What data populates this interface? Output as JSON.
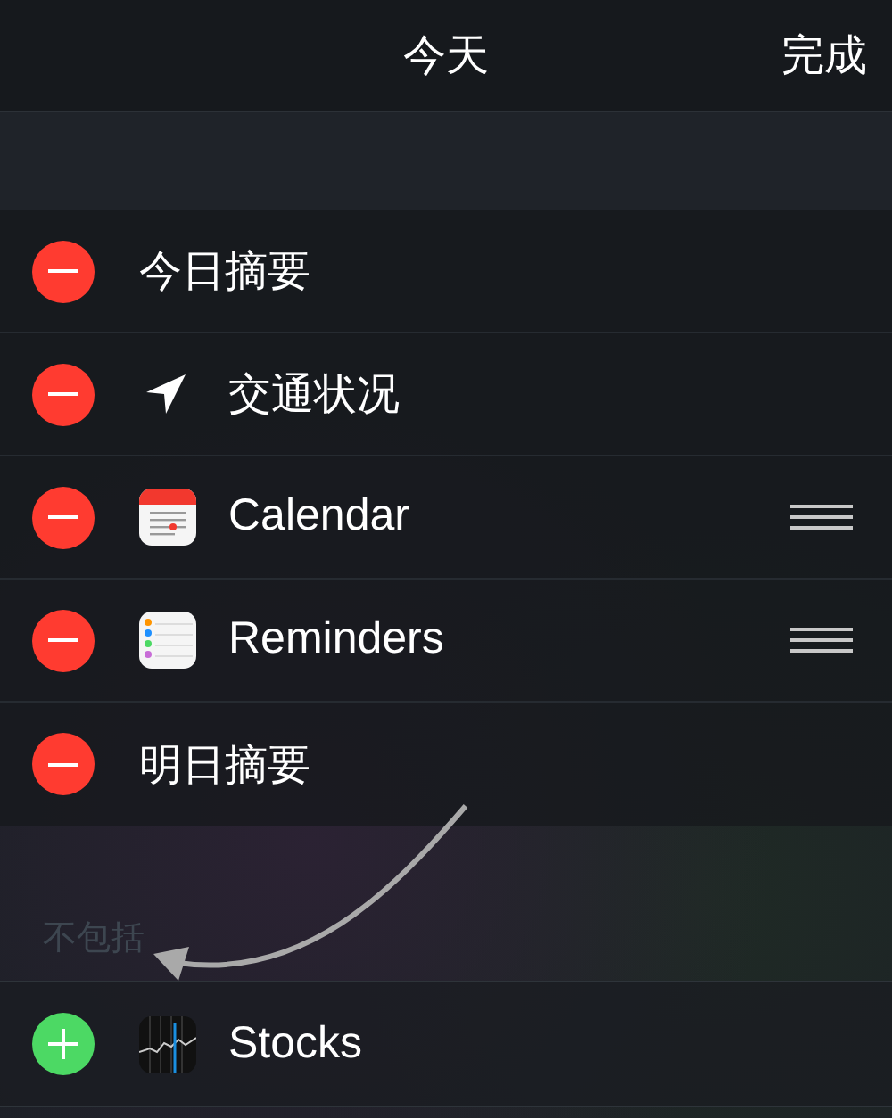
{
  "nav_bar": {
    "title": "今天",
    "done_button": "完成"
  },
  "included": [
    {
      "label": "今日摘要",
      "kind": "text",
      "reorderable": false
    },
    {
      "label": "交通状况",
      "kind": "location",
      "reorderable": false
    },
    {
      "label": "Calendar",
      "kind": "calendar",
      "reorderable": true
    },
    {
      "label": "Reminders",
      "kind": "reminders",
      "reorderable": true
    },
    {
      "label": "明日摘要",
      "kind": "text",
      "reorderable": false
    }
  ],
  "excluded_section": {
    "header": "不包括",
    "rows": [
      {
        "label": "Stocks",
        "kind": "stocks",
        "reorderable": false
      }
    ]
  }
}
